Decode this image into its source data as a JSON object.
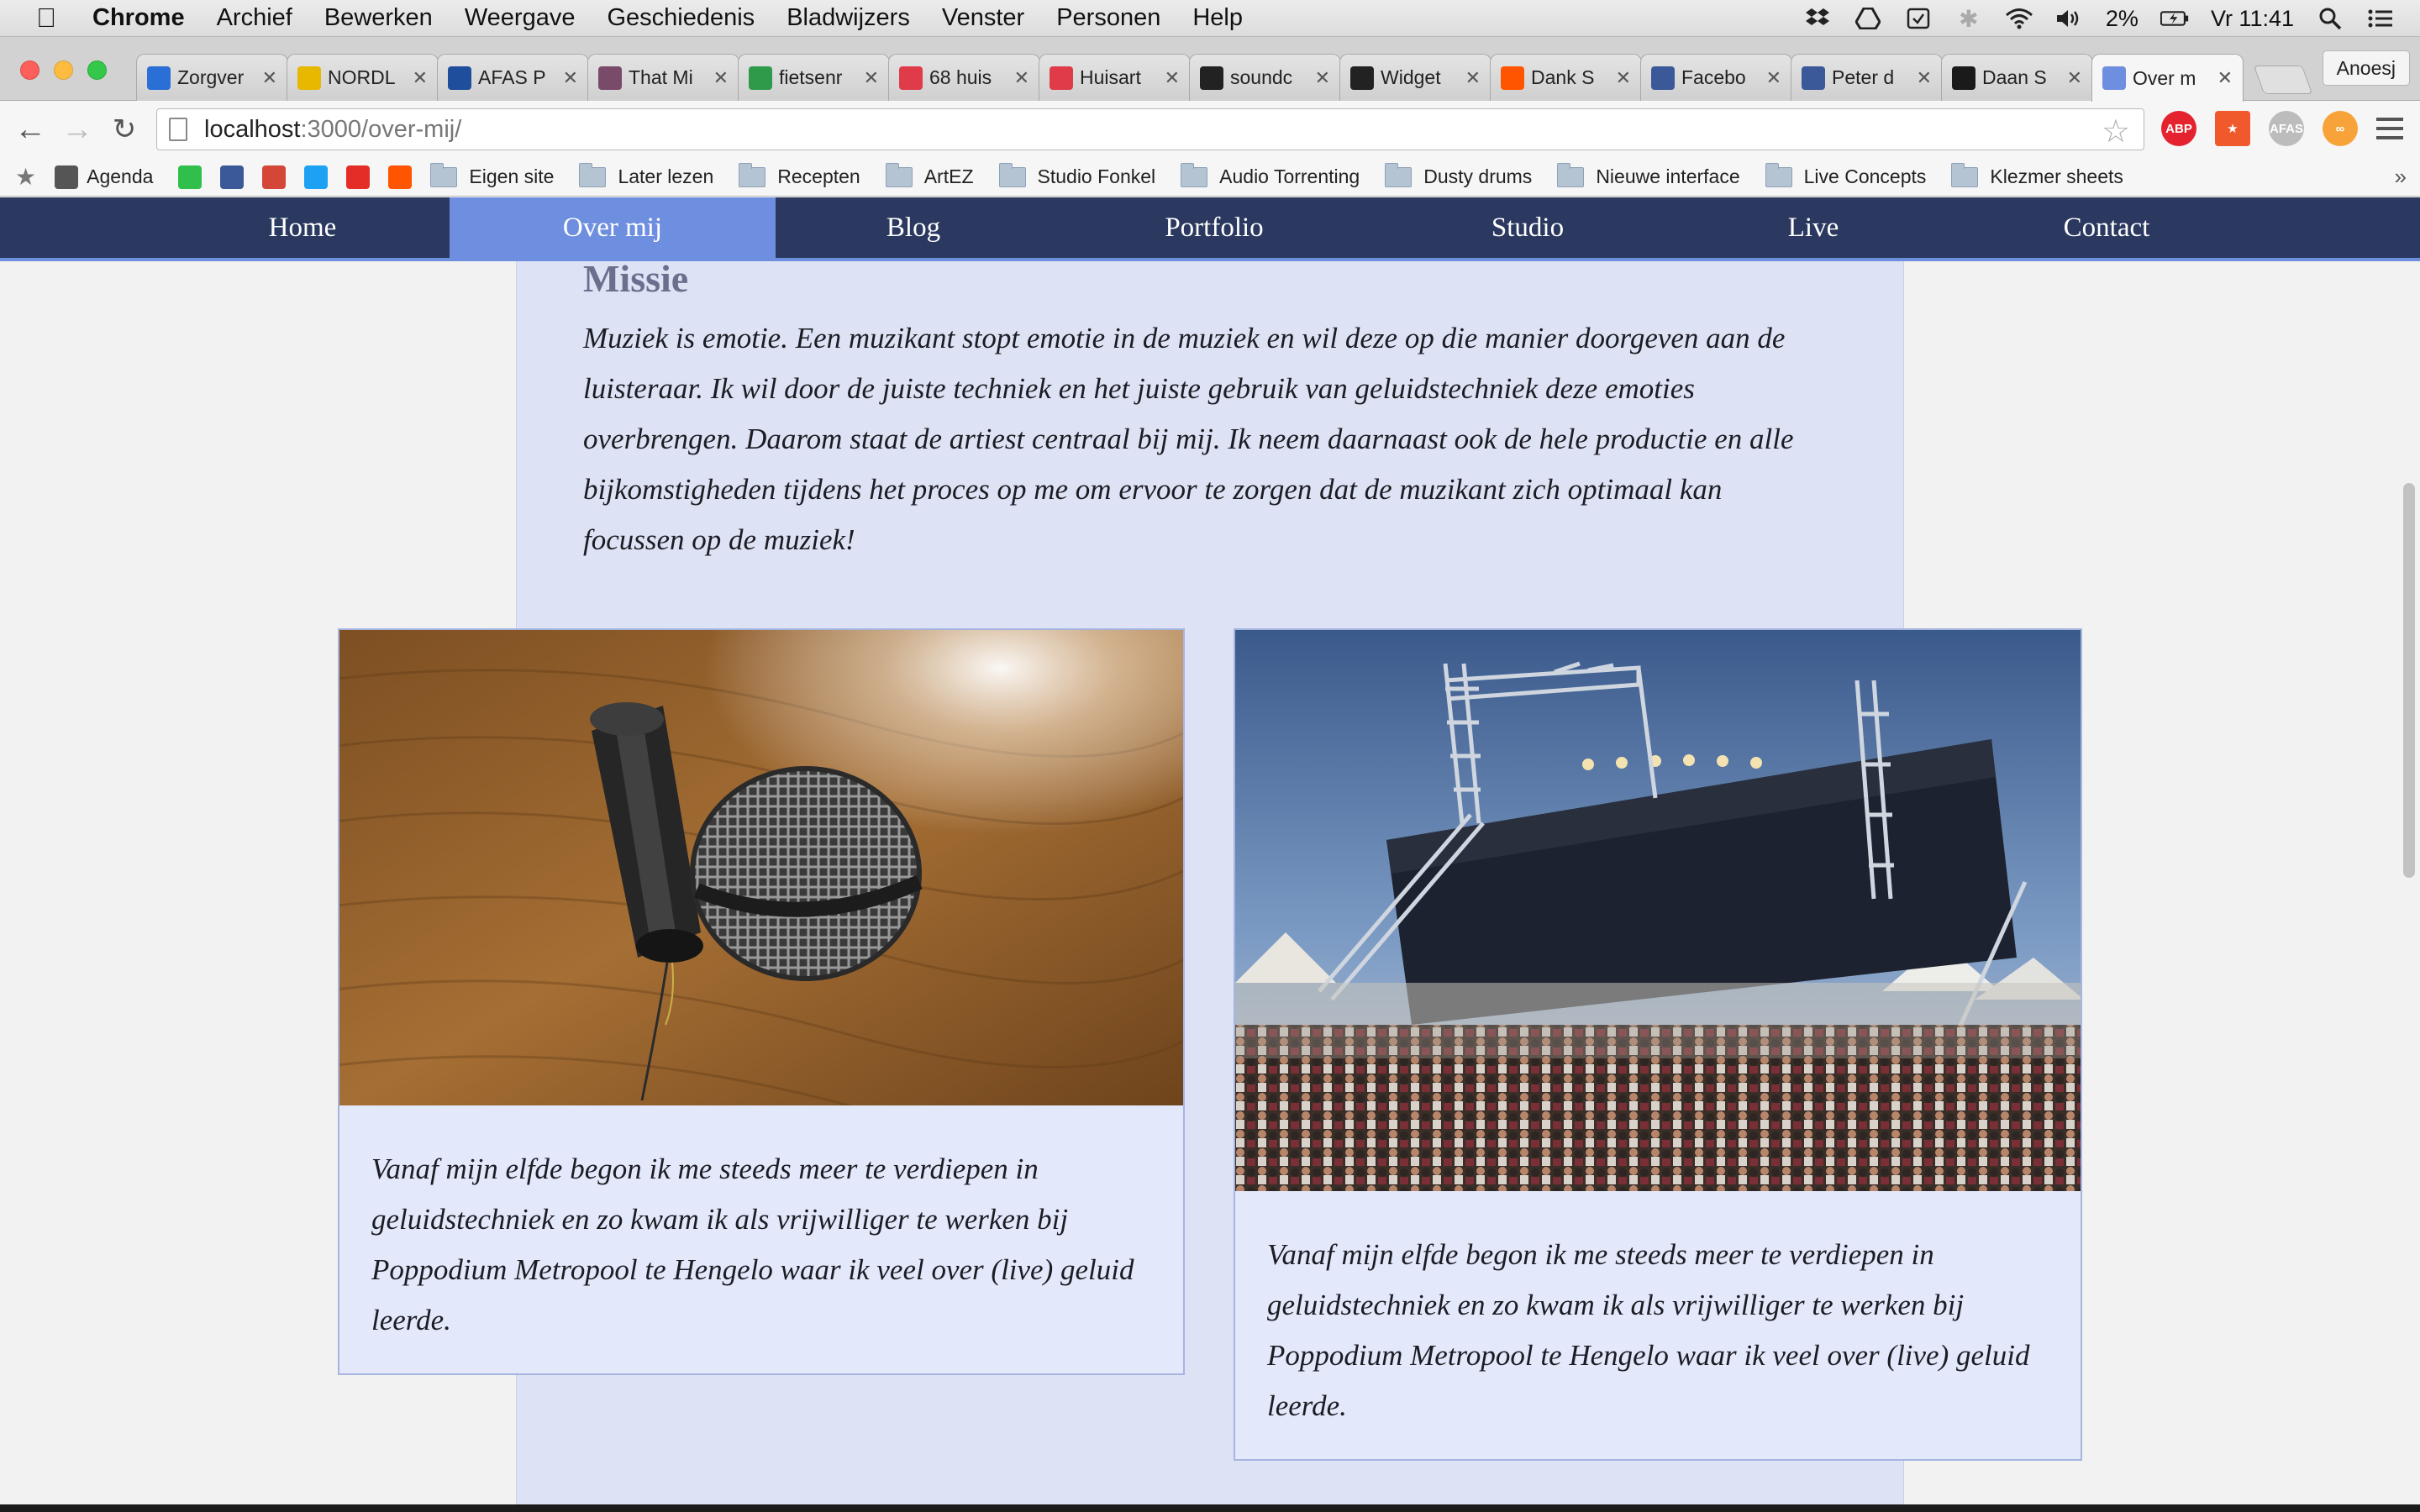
{
  "menubar": {
    "app": "Chrome",
    "items": [
      "Archief",
      "Bewerken",
      "Weergave",
      "Geschiedenis",
      "Bladwijzers",
      "Venster",
      "Personen",
      "Help"
    ],
    "battery": "2%",
    "clock": "Vr 11:41"
  },
  "tabs": [
    {
      "label": "Zorgver",
      "icon": "plus-cross-icon",
      "color": "#2a6fd6"
    },
    {
      "label": "NORDL",
      "icon": "nordl-icon",
      "color": "#e8b700"
    },
    {
      "label": "AFAS P",
      "icon": "afas-icon",
      "color": "#1f4e9c"
    },
    {
      "label": "That Mi",
      "icon": "avatar-icon",
      "color": "#7a4a6b"
    },
    {
      "label": "fietsenr",
      "icon": "maps-icon",
      "color": "#2f9a4a"
    },
    {
      "label": "68 huis",
      "icon": "red-cross-icon",
      "color": "#e03b49"
    },
    {
      "label": "Huisart",
      "icon": "red-cross-icon",
      "color": "#e03b49"
    },
    {
      "label": "soundc",
      "icon": "github-icon",
      "color": "#222222"
    },
    {
      "label": "Widget",
      "icon": "github-icon",
      "color": "#222222"
    },
    {
      "label": "Dank S",
      "icon": "soundcloud-icon",
      "color": "#ff5500"
    },
    {
      "label": "Facebo",
      "icon": "facebook-icon",
      "color": "#3b5998"
    },
    {
      "label": "Peter d",
      "icon": "facebook-icon",
      "color": "#3b5998"
    },
    {
      "label": "Daan S",
      "icon": "imdb-icon",
      "color": "#1a1a1a"
    },
    {
      "label": "Over m",
      "icon": "site-icon",
      "color": "#6e8fe0"
    }
  ],
  "profile": "Anoesj",
  "toolbar": {
    "url_host": "localhost",
    "url_rest": ":3000/over-mij/"
  },
  "bookmarks": [
    {
      "label": "Agenda",
      "type": "site",
      "icon": "apple-icon",
      "color": "#555555"
    },
    {
      "label": "",
      "type": "site",
      "icon": "whatsapp-icon",
      "color": "#2fbf4a"
    },
    {
      "label": "",
      "type": "site",
      "icon": "facebook-icon",
      "color": "#3b5998"
    },
    {
      "label": "",
      "type": "site",
      "icon": "gmail-icon",
      "color": "#d44638"
    },
    {
      "label": "",
      "type": "site",
      "icon": "twitter-icon",
      "color": "#1da1f2"
    },
    {
      "label": "",
      "type": "site",
      "icon": "youtube-icon",
      "color": "#e52d27"
    },
    {
      "label": "",
      "type": "site",
      "icon": "soundcloud-icon",
      "color": "#ff5500"
    },
    {
      "label": "Eigen site",
      "type": "folder"
    },
    {
      "label": "Later lezen",
      "type": "folder"
    },
    {
      "label": "Recepten",
      "type": "folder"
    },
    {
      "label": "ArtEZ",
      "type": "folder"
    },
    {
      "label": "Studio Fonkel",
      "type": "folder"
    },
    {
      "label": "Audio Torrenting",
      "type": "folder"
    },
    {
      "label": "Dusty drums",
      "type": "folder"
    },
    {
      "label": "Nieuwe interface",
      "type": "folder"
    },
    {
      "label": "Live Concepts",
      "type": "folder"
    },
    {
      "label": "Klezmer sheets",
      "type": "folder"
    }
  ],
  "sitenav": [
    {
      "label": "Home",
      "active": false
    },
    {
      "label": "Over mij",
      "active": true
    },
    {
      "label": "Blog",
      "active": false
    },
    {
      "label": "Portfolio",
      "active": false
    },
    {
      "label": "Studio",
      "active": false
    },
    {
      "label": "Live",
      "active": false
    },
    {
      "label": "Contact",
      "active": false
    }
  ],
  "missie": {
    "title": "Missie",
    "text": "Muziek is emotie. Een muzikant stopt emotie in de muziek en wil deze op die manier doorgeven aan de luisteraar. Ik wil door de juiste techniek en het juiste gebruik van geluidstechniek deze emoties overbrengen. Daarom staat de artiest centraal bij mij. Ik neem daarnaast ook de hele productie en alle bijkomstigheden tijdens het proces op me om ervoor te zorgen dat de muzikant zich optimaal kan focussen op de muziek!"
  },
  "cards": [
    {
      "caption": "Vanaf mijn elfde begon ik me steeds meer te verdiepen in geluidstechniek en zo kwam ik als vrijwilliger te werken bij Poppodium Metropool te Hengelo waar ik veel over (live) geluid leerde."
    },
    {
      "caption": "Vanaf mijn elfde begon ik me steeds meer te verdiepen in geluidstechniek en zo kwam ik als vrijwilliger te werken bij Poppodium Metropool te Hengelo waar ik veel over (live) geluid leerde."
    }
  ],
  "colors": {
    "nav_bg": "#2b3960",
    "nav_active": "#6e8fe0",
    "content_bg": "#dde3f4",
    "card_bg": "#e3e9fb",
    "card_border": "#a6b5e0"
  }
}
